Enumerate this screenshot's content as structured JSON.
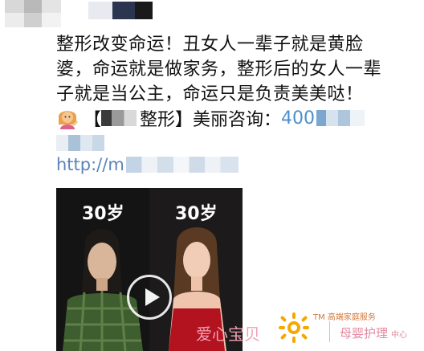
{
  "post": {
    "lines": [
      "整形改变命运！丑女人一辈子就是黄脸",
      "婆，命运就是做家务，整形后的女人一辈",
      "子就是当公主，命运只是负责美美哒！"
    ],
    "promo_bracket_open": "【",
    "promo_clinic_suffix": "整形】美丽咨询：",
    "promo_phone_prefix": "400",
    "link_prefix": "http://m"
  },
  "video": {
    "left_label": "30岁",
    "right_label": "30岁"
  },
  "watermark": {
    "brand": "爱心宝贝",
    "tm_line": "TM 高端家庭服务",
    "service": "母婴护理",
    "service_suffix": "中心"
  },
  "colors": {
    "phone": "#4b8fcf",
    "link": "#5a84b8",
    "watermark_pink": "#f0a0b4",
    "watermark_orange": "#f5a800"
  }
}
